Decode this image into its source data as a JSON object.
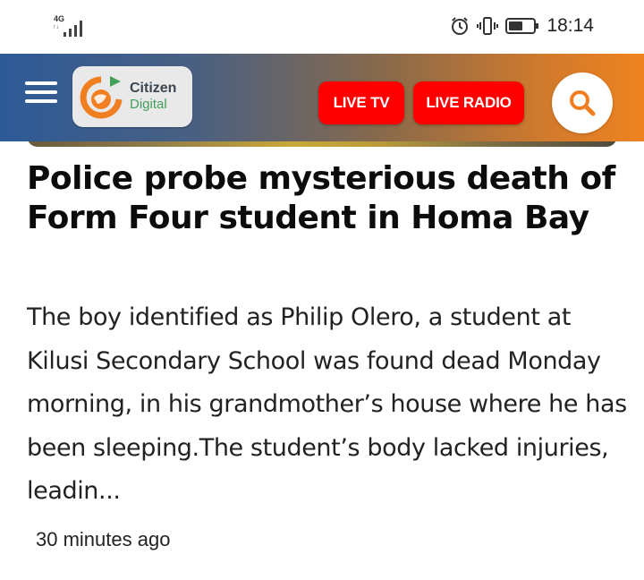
{
  "status_bar": {
    "network_type": "4G",
    "network_sub": "↑↓",
    "time": "18:14",
    "icons": [
      "signal-icon",
      "alarm-icon",
      "vibrate-icon",
      "battery-icon"
    ]
  },
  "header": {
    "menu_icon": "hamburger-menu-icon",
    "logo_line1": "Citizen",
    "logo_line2": "Digital",
    "live_tv_label": "LIVE TV",
    "live_radio_label": "LIVE RADIO",
    "search_icon": "search-icon",
    "colors": {
      "gradient_start": "#2d5a97",
      "gradient_end": "#ee8320",
      "live_button": "#ff0000",
      "logo_orange": "#f07f22",
      "logo_green": "#42a05a"
    }
  },
  "article": {
    "headline": "Police probe mysterious death of Form Four student in Homa Bay",
    "summary": "The boy identified as Philip Olero, a student at Kilusi Secondary School was found dead Monday morning, in his grandmother’s house where he has been sleeping.The student’s body lacked injuries, leadin...",
    "timestamp": "30 minutes ago"
  }
}
